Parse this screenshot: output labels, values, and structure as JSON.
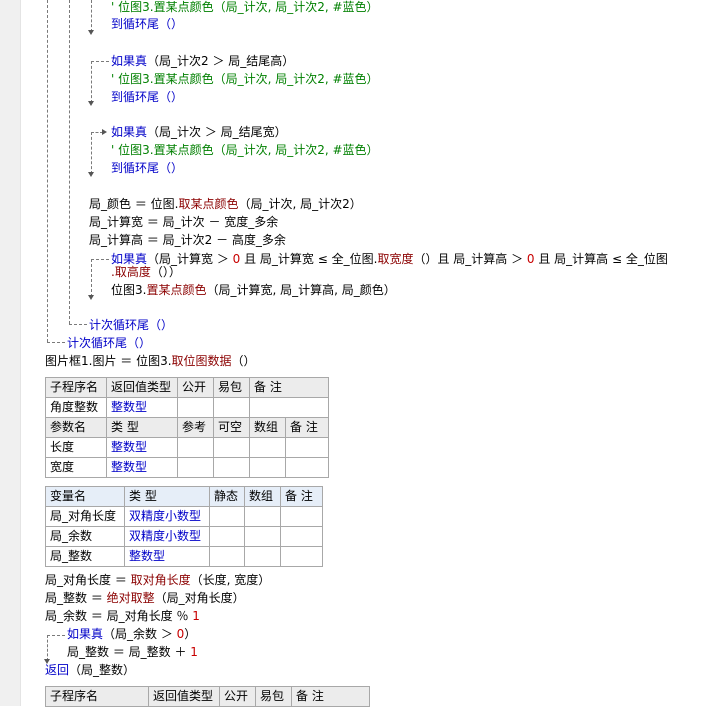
{
  "lines": {
    "l1": {
      "c": "' 位图3.置某点颜色（局_计次, 局_计次2, #蓝色）"
    },
    "l2": {
      "k": "到循环尾（）"
    },
    "l3": {
      "k": "如果真",
      "t": "（局_计次2 ＞ 局_结尾高）"
    },
    "l4": {
      "c": "' 位图3.置某点颜色（局_计次, 局_计次2, #蓝色）"
    },
    "l5": {
      "k": "到循环尾（）"
    },
    "l6": {
      "k": "如果真",
      "t": "（局_计次 ＞ 局_结尾宽）"
    },
    "l7": {
      "c": "' 位图3.置某点颜色（局_计次, 局_计次2, #蓝色）"
    },
    "l8": {
      "k": "到循环尾（）"
    },
    "l9": {
      "a": "局_颜色 ＝ 位图.",
      "f": "取某点颜色",
      "b": "（局_计次, 局_计次2）"
    },
    "l10": {
      "t": "局_计算宽 ＝ 局_计次 － 宽度_多余"
    },
    "l11": {
      "t": "局_计算高 ＝ 局_计次2 － 高度_多余"
    },
    "l12": {
      "k": "如果真",
      "a": "（局_计算宽 ＞ ",
      "n1": "0",
      "b": " 且 局_计算宽 ≤ 全_位图.",
      "f1": "取宽度",
      "c2": "（）且 局_计算高 ＞ ",
      "n2": "0",
      "d": " 且 局_计算高 ≤ 全_位图"
    },
    "l12b": {
      "f": ".取高度",
      "t": "（））"
    },
    "l13": {
      "a": "位图3.",
      "f": "置某点颜色",
      "b": "（局_计算宽, 局_计算高, 局_颜色）"
    },
    "l14": {
      "k": "计次循环尾（）"
    },
    "l15": {
      "k": "计次循环尾（）"
    },
    "l16": {
      "a": "图片框1.图片 ＝ 位图3.",
      "f": "取位图数据",
      "b": "（）"
    }
  },
  "sub_table": {
    "headers": [
      "子程序名",
      "返回值类型",
      "公开",
      "易包",
      "备 注"
    ],
    "row": {
      "name": "角度整数",
      "type": "整数型",
      "public": "",
      "pack": "",
      "note": ""
    },
    "param_headers": [
      "参数名",
      "类 型",
      "参考",
      "可空",
      "数组",
      "备 注"
    ],
    "params": [
      {
        "name": "长度",
        "type": "整数型"
      },
      {
        "name": "宽度",
        "type": "整数型"
      }
    ]
  },
  "var_table": {
    "headers": [
      "变量名",
      "类 型",
      "静态",
      "数组",
      "备 注"
    ],
    "vars": [
      {
        "name": "局_对角长度",
        "type": "双精度小数型"
      },
      {
        "name": "局_余数",
        "type": "双精度小数型"
      },
      {
        "name": "局_整数",
        "type": "整数型"
      }
    ]
  },
  "body2": {
    "b1": {
      "a": "局_对角长度 ＝ ",
      "f": "取对角长度",
      "b": "（长度, 宽度）"
    },
    "b2": {
      "a": "局_整数 ＝ ",
      "f": "绝对取整",
      "b": "（局_对角长度）"
    },
    "b3": {
      "a": "局_余数 ＝ 局_对角长度 ％ ",
      "n": "1"
    },
    "b4": {
      "k": "如果真",
      "a": "（局_余数 ＞ ",
      "n": "0",
      "b": "）"
    },
    "b5": {
      "a": "局_整数 ＝ 局_整数 ＋ ",
      "n": "1"
    },
    "b6": {
      "k": "返回",
      "t": "（局_整数）"
    }
  },
  "sub_table2": {
    "headers": [
      "子程序名",
      "返回值类型",
      "公开",
      "易包",
      "备 注"
    ]
  }
}
